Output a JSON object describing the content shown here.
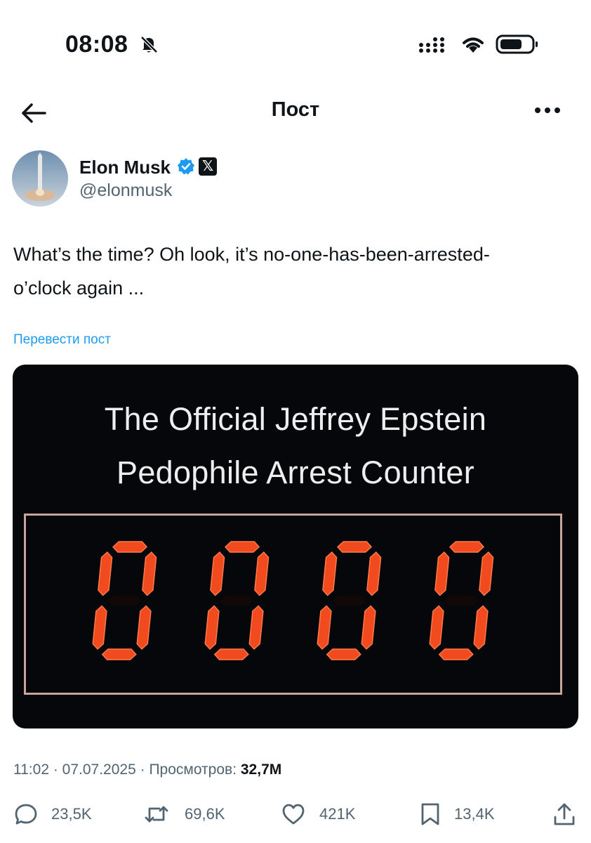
{
  "status_bar": {
    "time": "08:08"
  },
  "header": {
    "title": "Пост"
  },
  "author": {
    "name": "Elon Musk",
    "handle": "@elonmusk",
    "badge": "𝕏"
  },
  "post": {
    "text_line1": "What’s the time? Oh look, it’s no-one-has-been-arrested-",
    "text_line2": "o’clock again ...",
    "translate_link": "Перевести пост"
  },
  "media": {
    "title_line1": "The Official Jeffrey Epstein",
    "title_line2": "Pedophile Arrest Counter",
    "counter_value": "0000",
    "digit_color": "#f04a1e"
  },
  "meta": {
    "time": "11:02",
    "date": "07.07.2025",
    "views_label": "Просмотров:",
    "views_value": "32,7M"
  },
  "actions": {
    "replies": "23,5K",
    "reposts": "69,6K",
    "likes": "421K",
    "bookmarks": "13,4K"
  },
  "icons": [
    "bell-slash-icon",
    "signal-icon",
    "wifi-icon",
    "battery-icon",
    "back-arrow-icon",
    "more-icon",
    "verified-icon",
    "reply-icon",
    "repost-icon",
    "like-icon",
    "bookmark-icon",
    "share-icon"
  ],
  "colors": {
    "accent": "#1d9bf0",
    "muted": "#536471",
    "text": "#0f1419"
  }
}
